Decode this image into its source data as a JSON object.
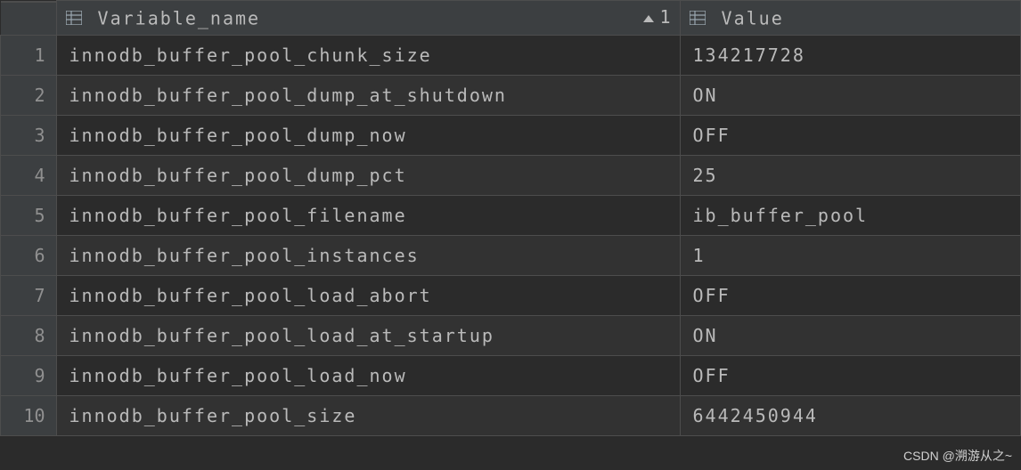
{
  "columns": {
    "variable_name": "Variable_name",
    "value": "Value",
    "sort_order": "1"
  },
  "rows": [
    {
      "num": "1",
      "name": "innodb_buffer_pool_chunk_size",
      "value": "134217728"
    },
    {
      "num": "2",
      "name": "innodb_buffer_pool_dump_at_shutdown",
      "value": "ON"
    },
    {
      "num": "3",
      "name": "innodb_buffer_pool_dump_now",
      "value": "OFF"
    },
    {
      "num": "4",
      "name": "innodb_buffer_pool_dump_pct",
      "value": "25"
    },
    {
      "num": "5",
      "name": "innodb_buffer_pool_filename",
      "value": "ib_buffer_pool"
    },
    {
      "num": "6",
      "name": "innodb_buffer_pool_instances",
      "value": "1"
    },
    {
      "num": "7",
      "name": "innodb_buffer_pool_load_abort",
      "value": "OFF"
    },
    {
      "num": "8",
      "name": "innodb_buffer_pool_load_at_startup",
      "value": "ON"
    },
    {
      "num": "9",
      "name": "innodb_buffer_pool_load_now",
      "value": "OFF"
    },
    {
      "num": "10",
      "name": "innodb_buffer_pool_size",
      "value": "6442450944"
    }
  ],
  "watermark": "CSDN @溯游从之~"
}
